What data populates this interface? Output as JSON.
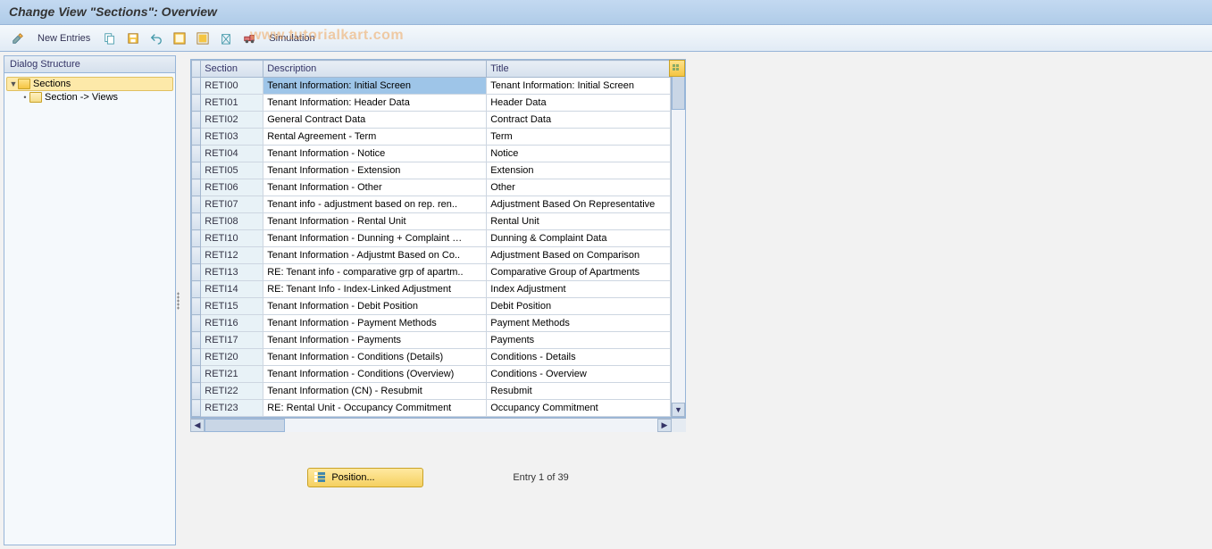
{
  "title": "Change View \"Sections\": Overview",
  "watermark": "www.tutorialkart.com",
  "toolbar": {
    "new_entries": "New Entries",
    "simulation": "Simulation"
  },
  "sidebar": {
    "header": "Dialog Structure",
    "items": [
      {
        "label": "Sections",
        "selected": true,
        "level": 0,
        "expandable": true,
        "open": true
      },
      {
        "label": "Section -> Views",
        "selected": false,
        "level": 1,
        "expandable": false,
        "open": false
      }
    ]
  },
  "table": {
    "columns": {
      "section": "Section",
      "description": "Description",
      "title": "Title"
    },
    "rows": [
      {
        "section": "RETI00",
        "description": "Tenant Information: Initial Screen",
        "title": "Tenant Information: Initial Screen",
        "selected": true
      },
      {
        "section": "RETI01",
        "description": "Tenant Information: Header Data",
        "title": "Header Data"
      },
      {
        "section": "RETI02",
        "description": "General Contract Data",
        "title": "Contract Data"
      },
      {
        "section": "RETI03",
        "description": "Rental Agreement - Term",
        "title": "Term"
      },
      {
        "section": "RETI04",
        "description": "Tenant Information - Notice",
        "title": "Notice"
      },
      {
        "section": "RETI05",
        "description": "Tenant Information - Extension",
        "title": "Extension"
      },
      {
        "section": "RETI06",
        "description": "Tenant Information - Other",
        "title": "Other"
      },
      {
        "section": "RETI07",
        "description": "Tenant info - adjustment based on rep. ren..",
        "title": "Adjustment Based On Representative"
      },
      {
        "section": "RETI08",
        "description": "Tenant Information - Rental Unit",
        "title": "Rental Unit"
      },
      {
        "section": "RETI10",
        "description": "Tenant Information - Dunning + Complaint …",
        "title": "Dunning & Complaint Data"
      },
      {
        "section": "RETI12",
        "description": "Tenant Information - Adjustmt Based on Co..",
        "title": "Adjustment Based on Comparison"
      },
      {
        "section": "RETI13",
        "description": "RE: Tenant info - comparative grp of apartm..",
        "title": "Comparative Group of Apartments"
      },
      {
        "section": "RETI14",
        "description": "RE: Tenant Info - Index-Linked Adjustment",
        "title": "Index Adjustment"
      },
      {
        "section": "RETI15",
        "description": "Tenant Information - Debit Position",
        "title": "Debit Position"
      },
      {
        "section": "RETI16",
        "description": "Tenant Information - Payment Methods",
        "title": "Payment Methods"
      },
      {
        "section": "RETI17",
        "description": "Tenant Information - Payments",
        "title": "Payments"
      },
      {
        "section": "RETI20",
        "description": "Tenant Information - Conditions (Details)",
        "title": "Conditions - Details"
      },
      {
        "section": "RETI21",
        "description": "Tenant Information - Conditions (Overview)",
        "title": "Conditions - Overview"
      },
      {
        "section": "RETI22",
        "description": "Tenant Information (CN) - Resubmit",
        "title": "Resubmit"
      },
      {
        "section": "RETI23",
        "description": "RE: Rental Unit - Occupancy Commitment",
        "title": "Occupancy Commitment"
      }
    ]
  },
  "footer": {
    "position_label": "Position...",
    "entry_text": "Entry 1 of 39"
  }
}
